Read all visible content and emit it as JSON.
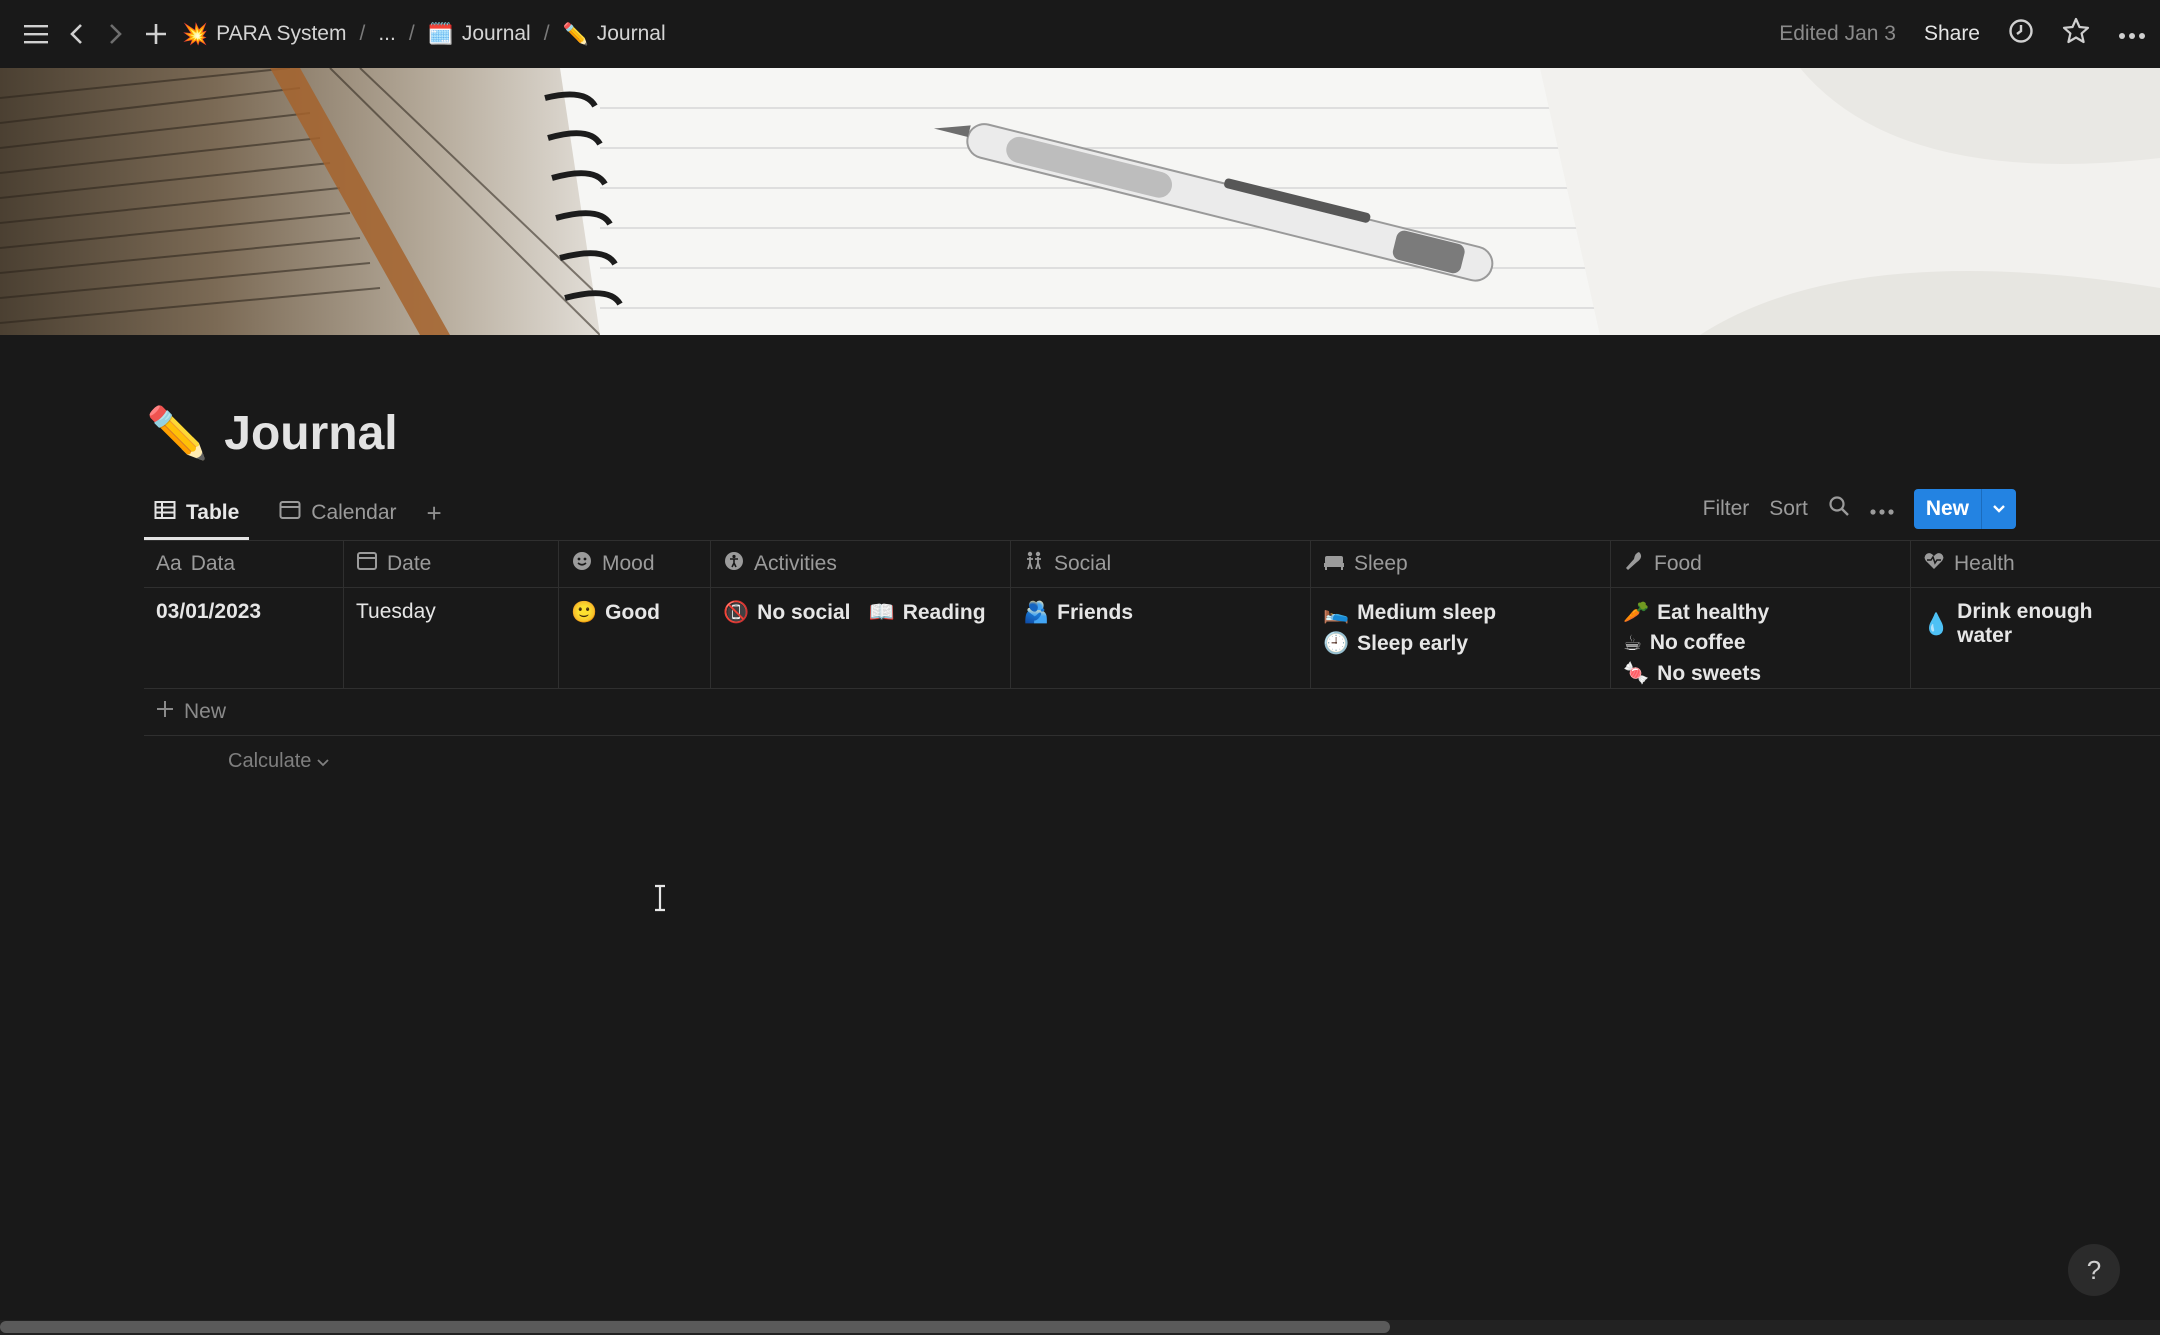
{
  "breadcrumb": [
    {
      "emoji": "💥",
      "label": "PARA System"
    },
    {
      "emoji": "",
      "label": "..."
    },
    {
      "emoji": "🗓️",
      "label": "Journal"
    },
    {
      "emoji": "✏️",
      "label": "Journal"
    }
  ],
  "topbar": {
    "edited": "Edited Jan 3",
    "share": "Share"
  },
  "page": {
    "emoji": "✏️",
    "title": "Journal"
  },
  "views": [
    {
      "label": "Table",
      "active": true
    },
    {
      "label": "Calendar",
      "active": false
    }
  ],
  "toolbar": {
    "filter": "Filter",
    "sort": "Sort",
    "new": "New"
  },
  "table": {
    "columns": [
      "Data",
      "Date",
      "Mood",
      "Activities",
      "Social",
      "Sleep",
      "Food",
      "Health"
    ],
    "column_prefix_data": "Aa",
    "rows": [
      {
        "data": "03/01/2023",
        "date": "Tuesday",
        "mood": [
          {
            "emoji": "🙂",
            "label": "Good"
          }
        ],
        "activities": [
          {
            "emoji": "📵",
            "label": "No social"
          },
          {
            "emoji": "📖",
            "label": "Reading"
          }
        ],
        "social": [
          {
            "emoji": "🫂",
            "label": "Friends"
          }
        ],
        "sleep": [
          {
            "emoji": "🛌",
            "label": "Medium sleep"
          },
          {
            "emoji": "🕘",
            "label": "Sleep early"
          }
        ],
        "food": [
          {
            "emoji": "🥕",
            "label": "Eat healthy"
          },
          {
            "emoji": "☕",
            "label": "No coffee"
          },
          {
            "emoji": "🍬",
            "label": "No sweets"
          }
        ],
        "health": [
          {
            "emoji": "💧",
            "label": "Drink enough water"
          }
        ]
      }
    ],
    "new_row": "New",
    "calculate": "Calculate"
  },
  "help": "?"
}
